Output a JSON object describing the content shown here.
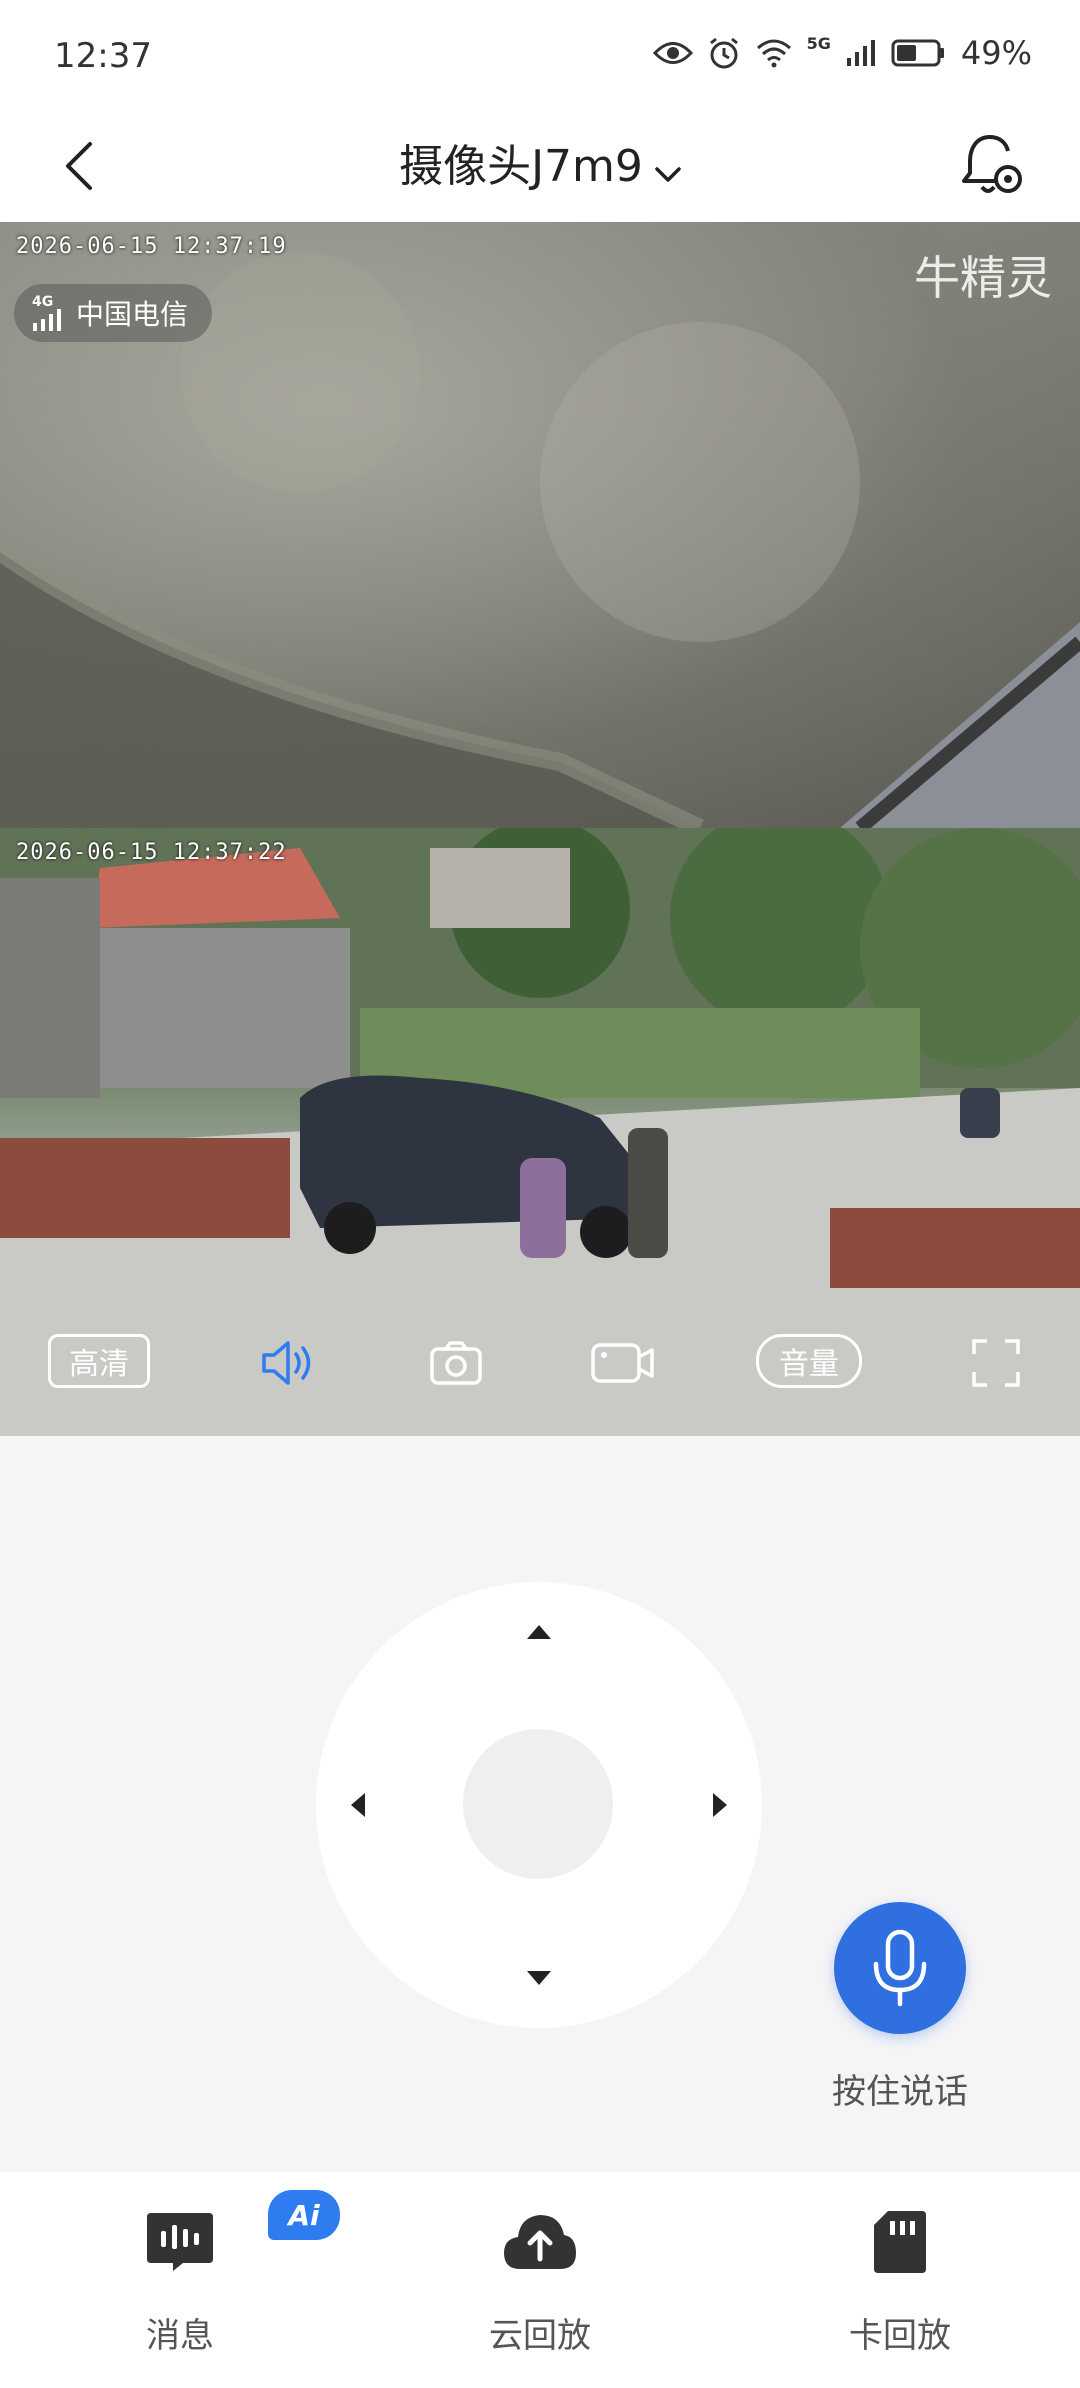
{
  "status_bar": {
    "time": "12:37",
    "network": "5G",
    "battery": "49%",
    "battery_level": 0.49
  },
  "header": {
    "title": "摄像头J7m9",
    "back_icon": "chevron-left-icon",
    "alarm_icon": "bell-settings-icon"
  },
  "video1": {
    "timestamp": "2026-06-15 12:37:19",
    "carrier_badge": "4G",
    "carrier": "中国电信",
    "watermark": "牛精灵"
  },
  "video2": {
    "timestamp": "2026-06-15 12:37:22"
  },
  "video_controls": {
    "quality": "高清",
    "speaker_icon": "speaker-icon",
    "snapshot_icon": "camera-icon",
    "record_icon": "video-record-icon",
    "volume": "音量",
    "fullscreen_icon": "fullscreen-icon"
  },
  "talk": {
    "label": "按住说话",
    "accent": "#2f6fe0"
  },
  "bottom_nav": {
    "ai_badge": "Ai",
    "items": [
      {
        "label": "消息",
        "icon": "message-icon"
      },
      {
        "label": "云回放",
        "icon": "cloud-upload-icon"
      },
      {
        "label": "卡回放",
        "icon": "sd-card-icon"
      }
    ]
  }
}
